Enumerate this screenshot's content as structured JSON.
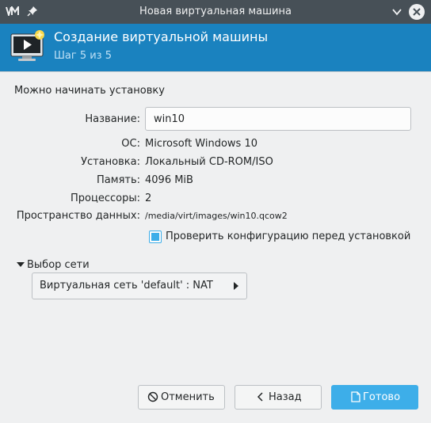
{
  "window": {
    "title": "Новая виртуальная машина"
  },
  "header": {
    "title": "Создание виртуальной машины",
    "step": "Шаг 5 из 5"
  },
  "main": {
    "subtitle": "Можно начинать установку",
    "name_label": "Название:",
    "name_value": "win10",
    "os_label": "ОС:",
    "os_value": "Microsoft Windows 10",
    "install_label": "Установка:",
    "install_value": "Локальный CD-ROM/ISO",
    "memory_label": "Память:",
    "memory_value": "4096 MiB",
    "cpu_label": "Процессоры:",
    "cpu_value": "2",
    "storage_label": "Пространство данных:",
    "storage_value": "/media/virt/images/win10.qcow2",
    "customize_label": "Проверить конфигурацию перед установкой",
    "customize_checked": true,
    "network_expander_label": "Выбор сети",
    "network_value": "Виртуальная сеть 'default' : NAT"
  },
  "buttons": {
    "cancel": "Отменить",
    "back": "Назад",
    "finish": "Готово"
  },
  "icons": {
    "app": "virt-manager-logo-icon",
    "pin": "pin-icon",
    "minimize": "chevron-down-icon",
    "close": "close-icon",
    "header": "monitor-play-icon",
    "cancel": "cancel-circle-icon",
    "back": "chevron-left-icon",
    "finish": "document-save-icon"
  },
  "colors": {
    "titlebar": "#475057",
    "header": "#1a82bf",
    "accent": "#3daee9",
    "background": "#eff0f1"
  }
}
